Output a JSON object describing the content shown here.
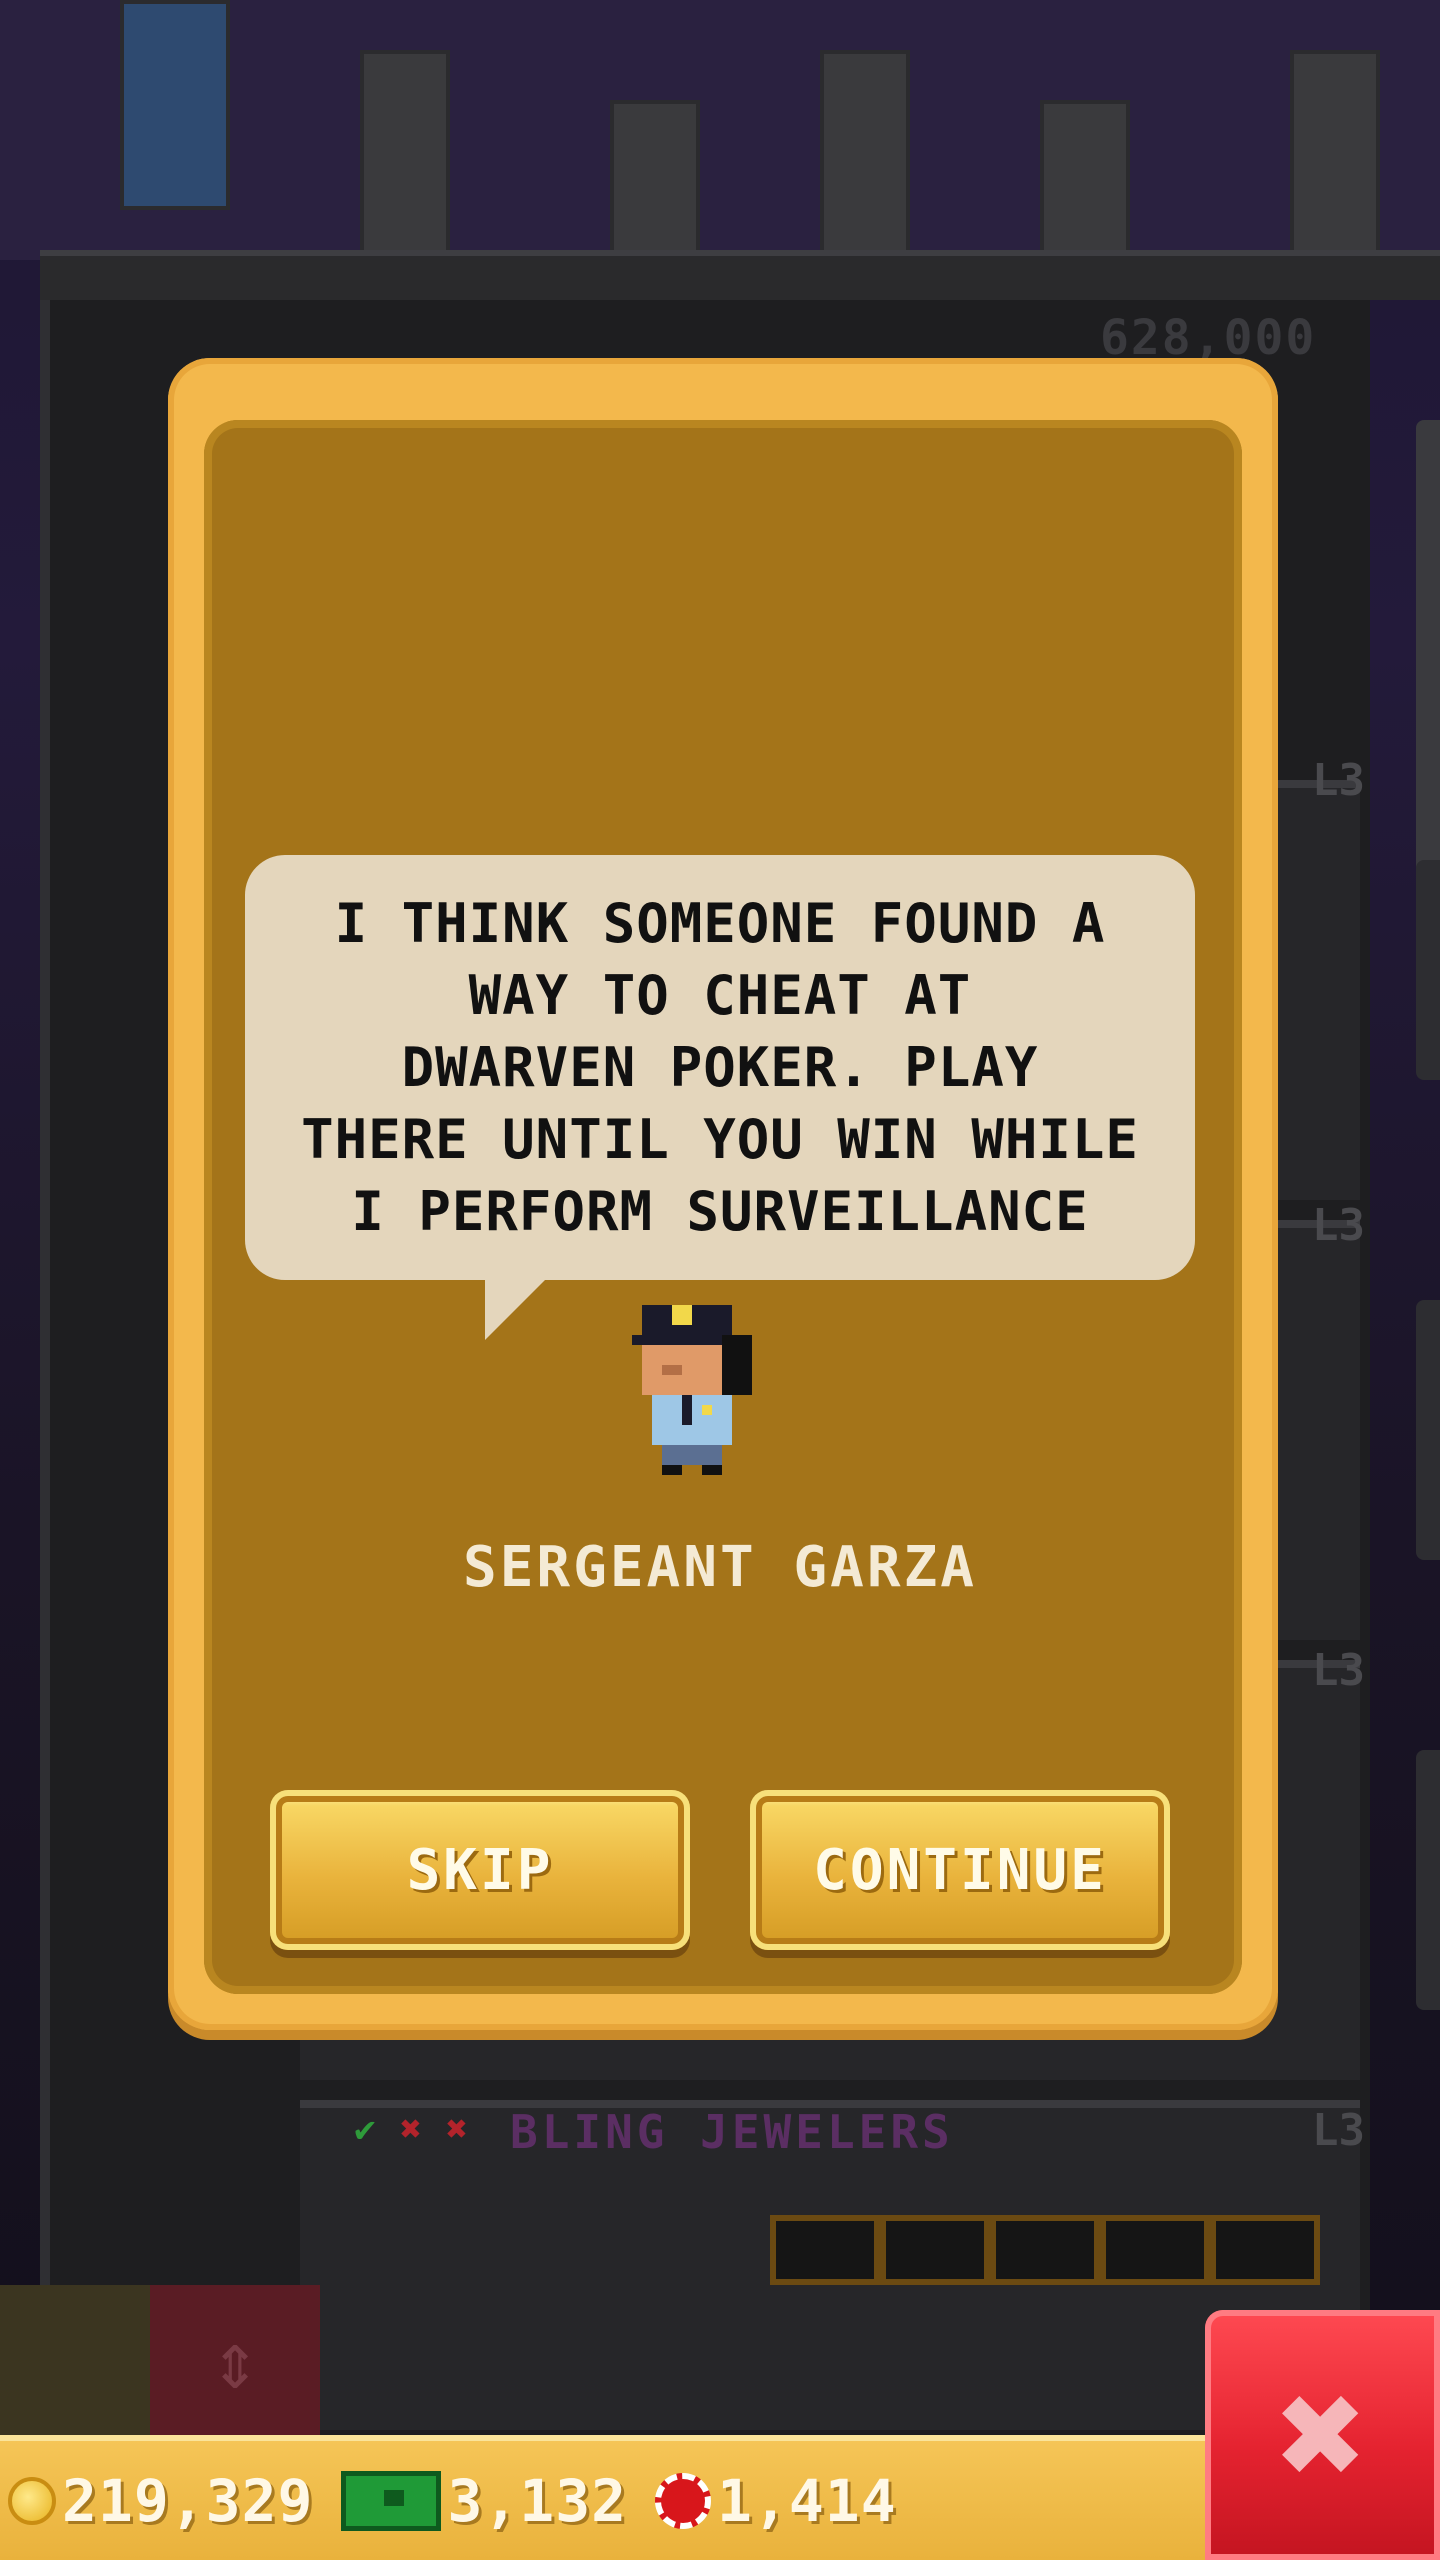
{
  "background": {
    "top_price": "628,000",
    "floor_levels": [
      "L3",
      "L3",
      "L3",
      "L3"
    ],
    "floor_name": "BLING JEWELERS",
    "floor_name_level": "L3",
    "stock_marks": [
      {
        "symbol": "✔",
        "color": "#2e9a3a"
      },
      {
        "symbol": "✖",
        "color": "#b3232b"
      },
      {
        "symbol": "✖",
        "color": "#b3232b"
      }
    ]
  },
  "dialog": {
    "speech": "I THINK SOMEONE FOUND A\nWAY TO CHEAT AT\nDWARVEN POKER. PLAY\nTHERE UNTIL YOU WIN WHILE\nI PERFORM SURVEILLANCE",
    "character_name": "SERGEANT GARZA",
    "skip_label": "SKIP",
    "continue_label": "CONTINUE"
  },
  "bottom_bar": {
    "coins": "219,329",
    "bux": "3,132",
    "chips": "1,414"
  },
  "icons": {
    "close": "close-icon",
    "coin": "coin-icon",
    "bux": "bux-icon",
    "chip": "chip-icon"
  },
  "colors": {
    "dialog_frame": "#f3b84c",
    "dialog_fill": "#a47419",
    "bubble": "#e4d6bc",
    "close_button": "#e52330",
    "bottom_bar": "#eeb848"
  }
}
